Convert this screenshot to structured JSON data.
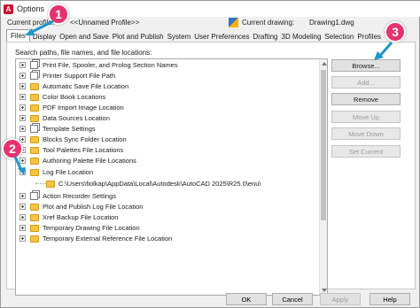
{
  "window": {
    "title": "Options"
  },
  "profile": {
    "label": "Current profile:",
    "value": "<<Unnamed Profile>>",
    "drawing_label": "Current drawing:",
    "drawing_value": "Drawing1.dwg"
  },
  "tabs": [
    {
      "label": "Files",
      "active": true
    },
    {
      "label": "Display"
    },
    {
      "label": "Open and Save"
    },
    {
      "label": "Plot and Publish"
    },
    {
      "label": "System"
    },
    {
      "label": "User Preferences"
    },
    {
      "label": "Drafting"
    },
    {
      "label": "3D Modeling"
    },
    {
      "label": "Selection"
    },
    {
      "label": "Profiles"
    }
  ],
  "tree": {
    "caption": "Search paths, file names, and file locations:",
    "items": [
      {
        "label": "Print File, Spooler, and Prolog Section Names",
        "icon": "pages-icon"
      },
      {
        "label": "Printer Support File Path",
        "icon": "folder-icon"
      },
      {
        "label": "Automatic Save File Location",
        "icon": "folder-icon"
      },
      {
        "label": "Color Book Locations",
        "icon": "folder-icon"
      },
      {
        "label": "PDF Import Image Location",
        "icon": "folder-icon"
      },
      {
        "label": "Data Sources Location",
        "icon": "folder-icon"
      },
      {
        "label": "Template Settings",
        "icon": "pages-icon"
      },
      {
        "label": "Blocks Sync Folder Location",
        "icon": "folder-icon"
      },
      {
        "label": "Tool Palettes File Locations",
        "icon": "folder-icon"
      },
      {
        "label": "Authoring Palette File Locations",
        "icon": "folder-icon"
      },
      {
        "label": "Log File Location",
        "icon": "folder-icon",
        "expanded": true
      },
      {
        "label": "C:\\Users\\fiolkap\\AppData\\Local\\Autodesk\\AutoCAD 2025\\R25.0\\enu\\",
        "icon": "folder-icon",
        "child": true
      },
      {
        "label": "Action Recorder Settings",
        "icon": "pages-icon"
      },
      {
        "label": "Plot and Publish Log File Location",
        "icon": "folder-icon"
      },
      {
        "label": "Xref Backup File Location",
        "icon": "folder-icon"
      },
      {
        "label": "Temporary Drawing File Location",
        "icon": "folder-icon"
      },
      {
        "label": "Temporary External Reference File Location",
        "icon": "folder-icon"
      }
    ]
  },
  "side_buttons": [
    {
      "label": "Browse...",
      "enabled": true
    },
    {
      "label": "Add...",
      "enabled": false
    },
    {
      "label": "Remove",
      "enabled": true
    },
    {
      "label": "Move Up",
      "enabled": false
    },
    {
      "label": "Move Down",
      "enabled": false
    },
    {
      "label": "Set Current",
      "enabled": false
    }
  ],
  "footer": {
    "ok": "OK",
    "cancel": "Cancel",
    "apply": "Apply",
    "help": "Help"
  },
  "callouts": {
    "one": "1",
    "two": "2",
    "three": "3"
  },
  "colors": {
    "badge": "#e6326e",
    "folder": "#f6c343"
  }
}
